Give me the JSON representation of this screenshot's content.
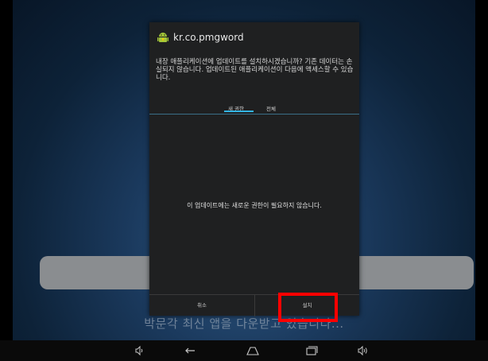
{
  "background": {
    "status_text": "박문각 최신 앱을 다운받고 있습니다..."
  },
  "dialog": {
    "app_name": "kr.co.pmgword",
    "app_icon": "android-robot-icon",
    "message": "내장 애플리케이션에 업데이트를 설치하시겠습니까? 기존 데이터는 손실되지 않습니다. 업데이트된 애플리케이션이 다음에 액세스할 수 있습니다.",
    "tabs": [
      {
        "label": "새 권한",
        "selected": true
      },
      {
        "label": "전체",
        "selected": false
      }
    ],
    "empty_message": "이 업데이트에는 새로운 권한이 필요하지 않습니다.",
    "buttons": {
      "cancel": "취소",
      "install": "설치"
    }
  },
  "navbar": {
    "icons": [
      "volume-down-icon",
      "back-icon",
      "home-icon",
      "recent-apps-icon",
      "volume-up-icon"
    ]
  },
  "colors": {
    "accent": "#33b5e5",
    "highlight": "#ff0000",
    "dialog_bg": "#1f2021"
  }
}
